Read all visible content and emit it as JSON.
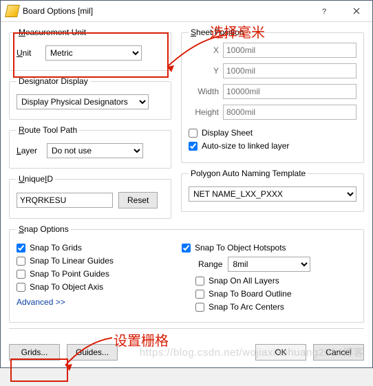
{
  "window": {
    "title": "Board Options [mil]"
  },
  "annotations": {
    "top_label": "选择毫米",
    "mid_label": "设置栅格"
  },
  "measurement": {
    "legend_u": "M",
    "legend_rest": "easurement Unit",
    "unit_u": "U",
    "unit_rest": "nit",
    "unit_value": "Metric"
  },
  "designator": {
    "legend": "Designator Display",
    "value": "Display Physical Designators"
  },
  "route": {
    "legend_u": "R",
    "legend_rest": "oute Tool Path",
    "layer_u": "L",
    "layer_rest": "ayer",
    "layer_value": "Do not use"
  },
  "uniqueid": {
    "legend_u": "U",
    "legend_rest": "nique",
    "legend_end": "D",
    "legend_i": "I",
    "value": "YRQRKESU",
    "reset": "Reset"
  },
  "sheet": {
    "legend_u": "S",
    "legend_rest": "heet Position",
    "x_label": "X",
    "x_value": "1000mil",
    "y_label": "Y",
    "y_value": "1000mil",
    "width_label": "Width",
    "width_value": "10000mil",
    "height_label": "Height",
    "height_value": "8000mil",
    "display_sheet": "Display Sheet",
    "auto_size": "Auto-size to linked layer"
  },
  "polygon": {
    "legend": "Polygon Auto Naming Template",
    "value": "NET NAME_LXX_PXXX"
  },
  "snap": {
    "legend_u": "S",
    "legend_rest": "nap Options",
    "to_grids": "Snap To Grids",
    "to_linear": "Snap To Linear Guides",
    "to_point": "Snap To Point Guides",
    "to_axis": "Snap To Object Axis",
    "advanced": "Advanced >>",
    "to_hotspots": "Snap To Object Hotspots",
    "range_label": "Range",
    "range_value": "8mil",
    "on_all_layers": "Snap On All Layers",
    "to_board_outline": "Snap To Board Outline",
    "to_arc_centers": "Snap To Arc Centers"
  },
  "footer": {
    "grids": "Grids...",
    "guides": "Guides...",
    "ok": "OK",
    "cancel": "Cancel"
  },
  "watermark": "https://blog.csdn.net/wojiaxiaohuang2014博客",
  "checked": {
    "display_sheet": false,
    "auto_size": true,
    "to_grids": true,
    "to_linear": false,
    "to_point": false,
    "to_axis": false,
    "to_hotspots": true,
    "on_all_layers": false,
    "to_board_outline": false,
    "to_arc_centers": false
  }
}
